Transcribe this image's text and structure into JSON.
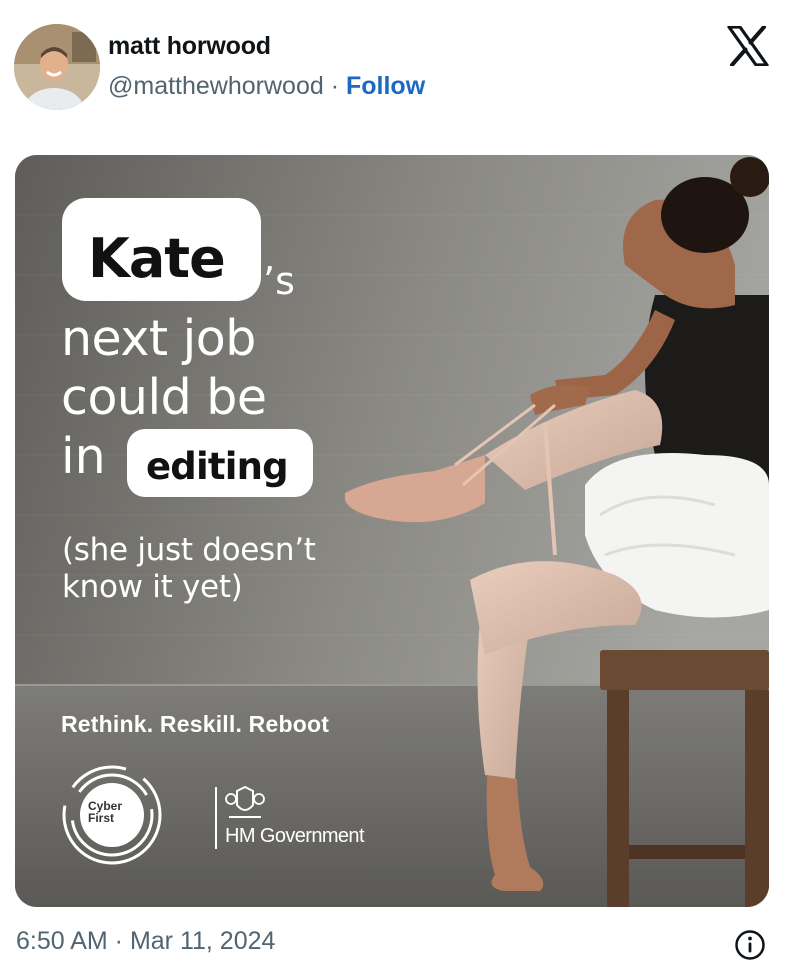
{
  "author": {
    "name": "matt horwood",
    "handle": "@matthewhorwood",
    "separator": "·",
    "follow_label": "Follow"
  },
  "header": {
    "platform_icon": "x-logo-icon"
  },
  "media": {
    "name_pill": "Kate",
    "possessive": "’s",
    "headline_line1": "next job",
    "headline_line2": "could be",
    "in_word": "in",
    "highlight_word": "editing",
    "sub_line1": "(she just doesn’t",
    "sub_line2": "know it yet)",
    "slogan": "Rethink. Reskill. Reboot",
    "cyber_line1": "Cyber",
    "cyber_line2": "First",
    "government": "HM Government"
  },
  "footer": {
    "timestamp": "6:50 AM · Mar 11, 2024",
    "info_icon": "info-icon"
  },
  "colors": {
    "link": "#1d68c4",
    "muted_text": "#536471",
    "primary_text": "#0f1419"
  }
}
